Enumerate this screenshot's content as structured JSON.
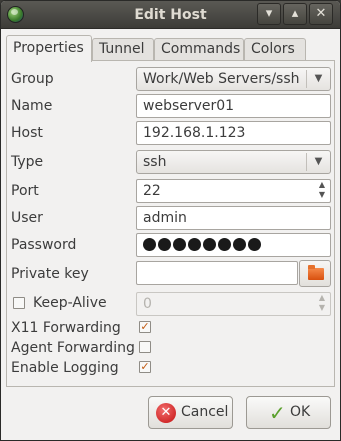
{
  "window": {
    "title": "Edit Host",
    "icon": "globe-icon",
    "controls": {
      "minimize": "minimize-icon",
      "maximize": "maximize-icon",
      "close": "close-icon"
    }
  },
  "tabs": [
    {
      "label": "Properties",
      "active": true
    },
    {
      "label": "Tunnel",
      "active": false
    },
    {
      "label": "Commands",
      "active": false
    },
    {
      "label": "Colors",
      "active": false
    }
  ],
  "form": {
    "group_label": "Group",
    "group_value": "Work/Web Servers/ssh",
    "name_label": "Name",
    "name_value": "webserver01",
    "host_label": "Host",
    "host_value": "192.168.1.123",
    "type_label": "Type",
    "type_value": "ssh",
    "port_label": "Port",
    "port_value": "22",
    "user_label": "User",
    "user_value": "admin",
    "password_label": "Password",
    "password_mask_count": 8,
    "private_key_label": "Private key",
    "private_key_value": "",
    "keepalive_label": "Keep-Alive",
    "keepalive_checked": false,
    "keepalive_value": "0",
    "x11_label": "X11 Forwarding",
    "x11_checked": true,
    "agent_label": "Agent Forwarding",
    "agent_checked": false,
    "logging_label": "Enable Logging",
    "logging_checked": true
  },
  "buttons": {
    "cancel_label": "Cancel",
    "ok_label": "OK"
  },
  "colors": {
    "titlebar": "#3d3c38",
    "window_bg": "#f2f1f0",
    "check_accent": "#c25b13",
    "cancel_icon": "#c41010",
    "ok_icon": "#5aa02c",
    "folder_icon": "#e5702c"
  }
}
